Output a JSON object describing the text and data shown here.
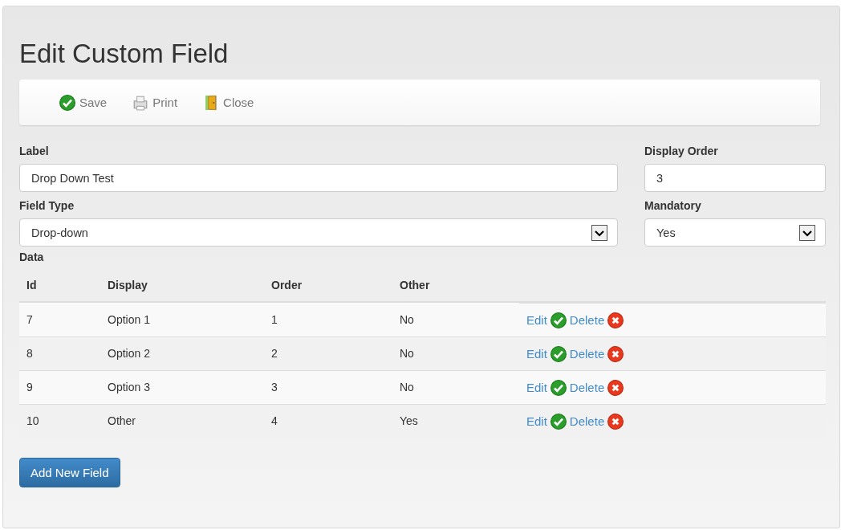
{
  "title": "Edit Custom Field",
  "toolbar": [
    {
      "kind": "save",
      "label": "Save"
    },
    {
      "kind": "print",
      "label": "Print"
    },
    {
      "kind": "close",
      "label": "Close"
    }
  ],
  "form": {
    "label": {
      "caption": "Label",
      "value": "Drop Down Test"
    },
    "display_order": {
      "caption": "Display Order",
      "value": "3"
    },
    "field_type": {
      "caption": "Field Type",
      "value": "Drop-down"
    },
    "mandatory": {
      "caption": "Mandatory",
      "value": "Yes"
    }
  },
  "data_caption": "Data",
  "table": {
    "columns": [
      "Id",
      "Display",
      "Order",
      "Other"
    ],
    "rows": [
      {
        "cells": [
          "7",
          "Option 1",
          "1",
          "No"
        ],
        "edit": "Edit",
        "delete": "Delete"
      },
      {
        "cells": [
          "8",
          "Option 2",
          "2",
          "No"
        ],
        "edit": "Edit",
        "delete": "Delete"
      },
      {
        "cells": [
          "9",
          "Option 3",
          "3",
          "No"
        ],
        "edit": "Edit",
        "delete": "Delete"
      },
      {
        "cells": [
          "10",
          "Other",
          "4",
          "Yes"
        ],
        "edit": "Edit",
        "delete": "Delete"
      }
    ]
  },
  "add_button": "Add New Field"
}
